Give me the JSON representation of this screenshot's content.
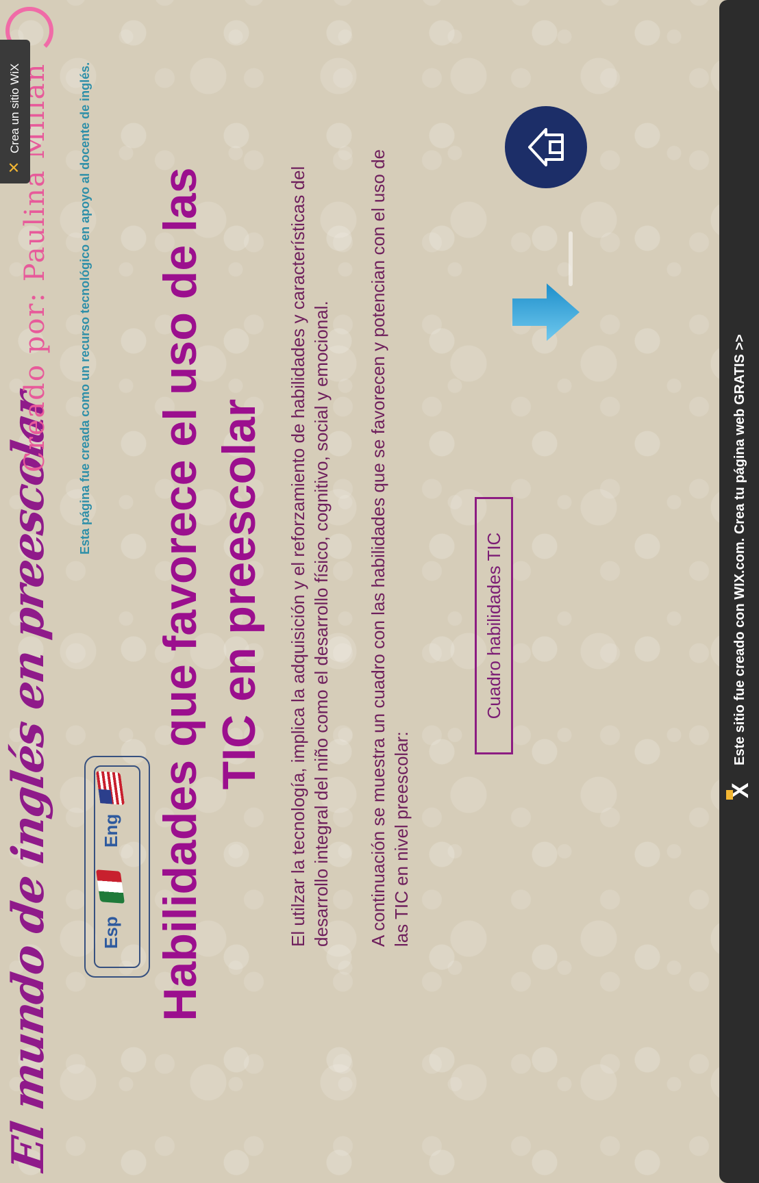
{
  "site": {
    "title": "El mundo de inglés en preescolar",
    "creator": "Creado por: Paulina Millán",
    "subtitle": "Esta página fue creada como un recurso tecnológico en apoyo al docente de inglés."
  },
  "language": {
    "esp_label": "Esp",
    "eng_label": "Eng"
  },
  "main": {
    "heading": "Habilidades que favorece el uso de las TIC en preescolar",
    "paragraph1": "El utilzar la tecnología, implica la adquisición y el reforzamiento de habilidades y características del desarrollo integral del niño como el desarrollo físico, cognitivo, social y emocional.",
    "paragraph2": "A continuación se muestra un cuadro con las habilidades que se favorecen y potencian con el uso de las TIC en nivel preescolar:",
    "cuadro_button": "Cuadro habilidades TIC"
  },
  "wix": {
    "badge_text": "Crea un sitio WiX",
    "footer_text": "Este sitio fue creado con WIX.com. Crea tu página web GRATIS >>"
  },
  "icons": {
    "home": "home-icon",
    "down_arrow": "down-arrow-icon",
    "flag_mx": "mexico-flag-icon",
    "flag_us": "usa-flag-icon",
    "wix_logo": "wix-logo-icon"
  },
  "colors": {
    "title": "#8f1a8a",
    "heading": "#9b0f8e",
    "creator": "#e75a9a",
    "subtitle": "#2f8fa8",
    "home_button": "#1c2e68",
    "arrow": "#2aa3d8",
    "footer": "#2c2c2c"
  }
}
